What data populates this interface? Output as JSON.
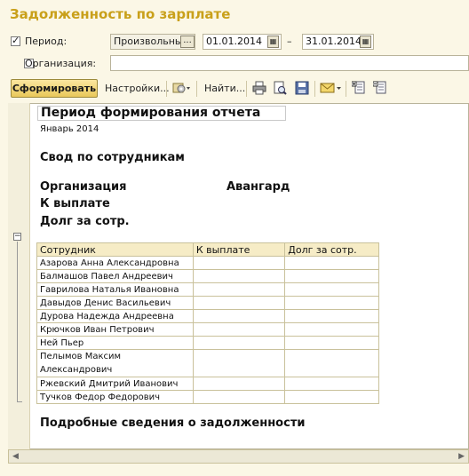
{
  "window": {
    "title": "Задолженность по зарплате"
  },
  "filters": {
    "period_checkbox_checked": true,
    "period_label": "Период:",
    "period_mode": "Произвольный",
    "period_mode_button": "...",
    "date_from": "01.01.2014",
    "date_separator": "–",
    "date_to": "31.01.2014",
    "org_checkbox_checked": false,
    "org_label": "Организация:",
    "org_value": ""
  },
  "toolbar": {
    "generate_label": "Сформировать",
    "settings_label": "Настройки...",
    "find_label": "Найти..."
  },
  "report": {
    "title": "Период формирования отчета",
    "period": "Январь 2014",
    "summary_heading": "Свод по сотрудникам",
    "org_label": "Организация",
    "org_value": "Авангард",
    "to_pay_label": "К выплате",
    "debt_label": "Долг за сотр.",
    "table": {
      "headers": [
        "Сотрудник",
        "К выплате",
        "Долг за сотр."
      ],
      "rows": [
        "Азарова Анна Александровна",
        "Балмашов Павел Андреевич",
        "Гаврилова Наталья Ивановна",
        "Давыдов Денис Васильевич",
        "Дурова Надежда Андреевна",
        "Крючков Иван Петрович",
        "Ней Пьер",
        "Пелымов Максим Александрович",
        "Ржевский Дмитрий Иванович",
        "Тучков Федор Федорович"
      ]
    },
    "details_heading": "Подробные сведения о задолженности"
  },
  "colors": {
    "title": "#c9a01a",
    "header_bg": "#f6ecc6",
    "window_bg": "#fbf7e6"
  }
}
